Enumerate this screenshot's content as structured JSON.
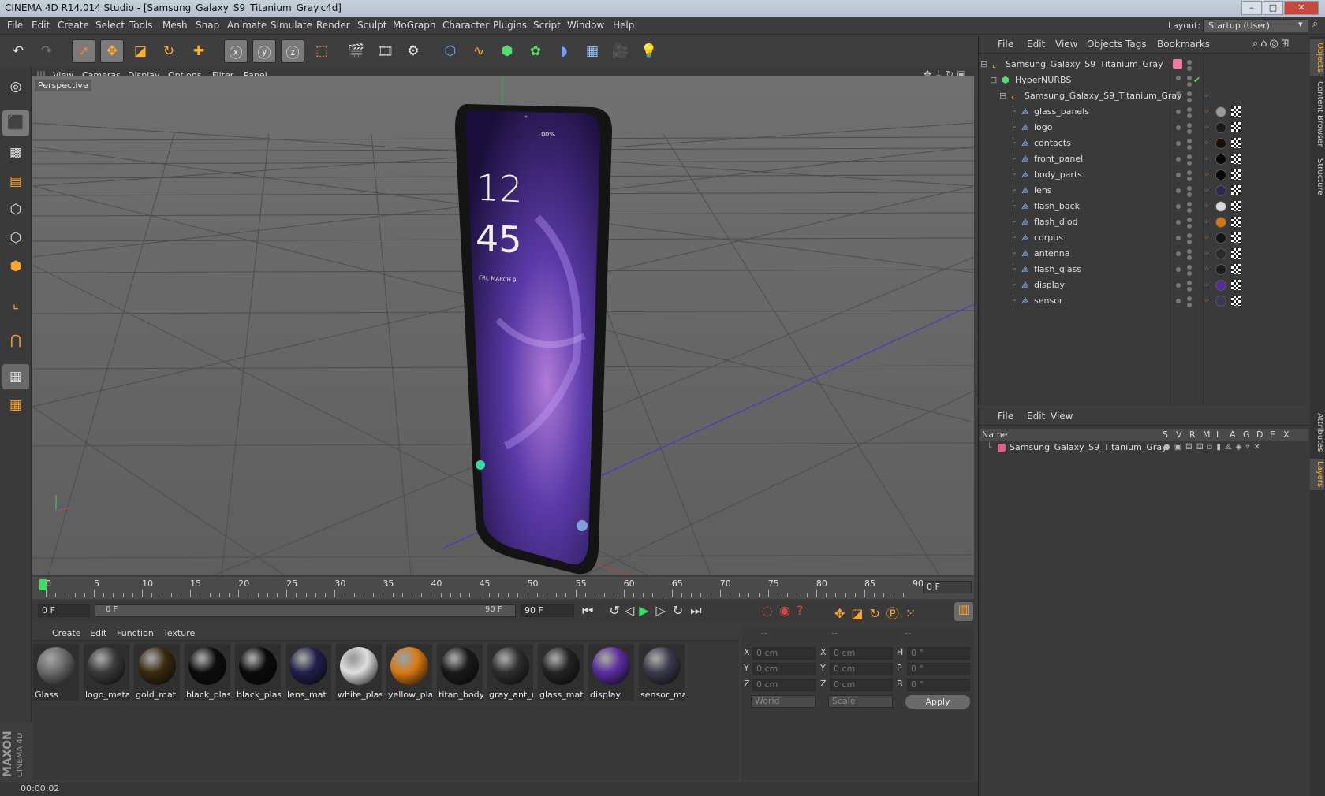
{
  "window": {
    "title": "CINEMA 4D R14.014 Studio - [Samsung_Galaxy_S9_Titanium_Gray.c4d]",
    "minimize": "–",
    "maximize": "□",
    "close": "✕"
  },
  "menu": [
    "File",
    "Edit",
    "Create",
    "Select",
    "Tools",
    "Mesh",
    "Snap",
    "Animate",
    "Simulate",
    "Render",
    "Sculpt",
    "MoGraph",
    "Character",
    "Plugins",
    "Script",
    "Window",
    "Help"
  ],
  "layout": {
    "label": "Layout:",
    "value": "Startup (User)"
  },
  "viewport": {
    "menu": [
      "View",
      "Cameras",
      "Display",
      "Options",
      "Filter",
      "Panel"
    ],
    "camera_label": "Perspective",
    "phone": {
      "hour": "12",
      "minute": "45",
      "status": "100%",
      "date": "FRI, MARCH 9"
    }
  },
  "object_manager": {
    "menu": [
      "File",
      "Edit",
      "View",
      "Objects",
      "Tags",
      "Bookmarks"
    ],
    "root": "Samsung_Galaxy_S9_Titanium_Gray",
    "hypernurbs": "HyperNURBS",
    "group": "Samsung_Galaxy_S9_Titanium_Gray",
    "objects": [
      {
        "name": "glass_panels",
        "tag": "#9a9a9a"
      },
      {
        "name": "logo",
        "tag": "#1a1a1a"
      },
      {
        "name": "contacts",
        "tag": "#1b1006"
      },
      {
        "name": "front_panel",
        "tag": "#080808"
      },
      {
        "name": "body_parts",
        "tag": "#0a0a0a"
      },
      {
        "name": "lens",
        "tag": "#2a2a55"
      },
      {
        "name": "flash_back",
        "tag": "#d8d8d8"
      },
      {
        "name": "flash_diod",
        "tag": "#d87510"
      },
      {
        "name": "corpus",
        "tag": "#151515"
      },
      {
        "name": "antenna",
        "tag": "#2b2b2b"
      },
      {
        "name": "flash_glass",
        "tag": "#1c1c1c"
      },
      {
        "name": "display",
        "tag": "#5a2a9a"
      },
      {
        "name": "sensor",
        "tag": "#3a3a50"
      }
    ]
  },
  "layer_manager": {
    "menu": [
      "File",
      "Edit",
      "View"
    ],
    "header": {
      "name": "Name",
      "cols": [
        "S",
        "V",
        "R",
        "M",
        "L",
        "A",
        "G",
        "D",
        "E",
        "X"
      ]
    },
    "layer": "Samsung_Galaxy_S9_Titanium_Gray",
    "layer_color": "#e05c8c"
  },
  "timeline": {
    "ticks": [
      "0",
      "5",
      "10",
      "15",
      "20",
      "25",
      "30",
      "35",
      "40",
      "45",
      "50",
      "55",
      "60",
      "65",
      "70",
      "75",
      "80",
      "85",
      "90"
    ],
    "current_frame": "0 F",
    "start_field": "0 F",
    "range_start": "0 F",
    "range_end": "90 F",
    "end_field": "90 F"
  },
  "material_manager": {
    "menu": [
      "Create",
      "Edit",
      "Function",
      "Texture"
    ],
    "materials": [
      {
        "name": "Glass",
        "color": "#6a6a6a"
      },
      {
        "name": "logo_metal",
        "color": "#3a3a3a"
      },
      {
        "name": "gold_mat",
        "color": "#3a2a10"
      },
      {
        "name": "black_plast",
        "color": "#0d0d0d"
      },
      {
        "name": "black_plast",
        "color": "#0b0b0b"
      },
      {
        "name": "lens_mat",
        "color": "#20204a"
      },
      {
        "name": "white_plas",
        "color": "#dedede"
      },
      {
        "name": "yellow_pla:",
        "color": "#d97a10"
      },
      {
        "name": "titan_body",
        "color": "#1a1a1a"
      },
      {
        "name": "gray_ant_m",
        "color": "#2e2e2e"
      },
      {
        "name": "glass_mat",
        "color": "#232323"
      },
      {
        "name": "display",
        "color": "#5b2da0"
      },
      {
        "name": "sensor_mat",
        "color": "#3a3a4a"
      }
    ]
  },
  "coordinates": {
    "headers": [
      "--",
      "--",
      "--"
    ],
    "rows": [
      {
        "a": "X",
        "av": "0 cm",
        "b": "X",
        "bv": "0 cm",
        "c": "H",
        "cv": "0 °"
      },
      {
        "a": "Y",
        "av": "0 cm",
        "b": "Y",
        "bv": "0 cm",
        "c": "P",
        "cv": "0 °"
      },
      {
        "a": "Z",
        "av": "0 cm",
        "b": "Z",
        "bv": "0 cm",
        "c": "B",
        "cv": "0 °"
      }
    ],
    "world": "World",
    "scale": "Scale",
    "apply": "Apply"
  },
  "side_tabs": [
    "Objects",
    "Content Browser",
    "Structure",
    "Attributes",
    "Layers"
  ],
  "status": {
    "time": "00:00:02"
  },
  "brand": {
    "line1": "MAXON",
    "line2": "CINEMA 4D"
  }
}
